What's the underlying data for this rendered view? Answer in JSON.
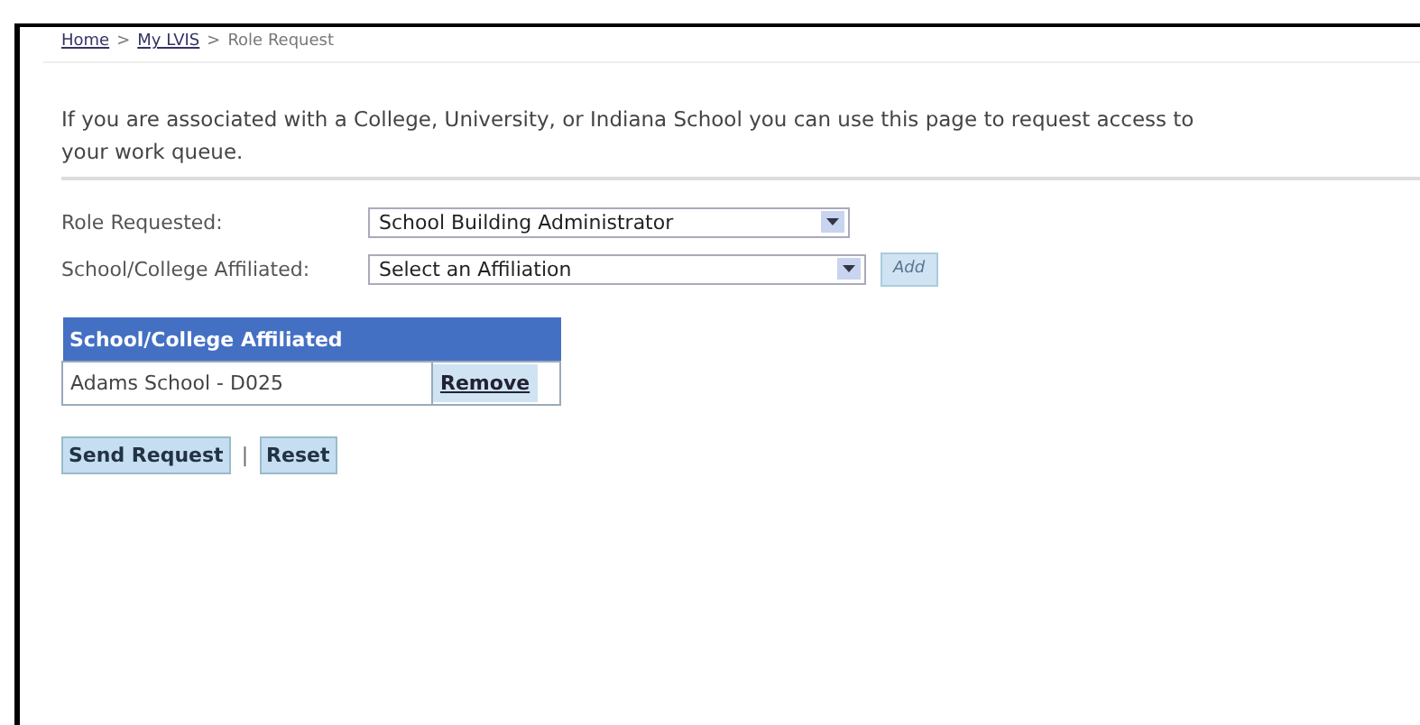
{
  "breadcrumb": [
    {
      "label": "Home",
      "link": true
    },
    {
      "label": "My LVIS",
      "link": true
    },
    {
      "label": "Role Request",
      "link": false
    }
  ],
  "breadcrumb_separator": ">",
  "intro": [
    "If you are associated with a College, University, or Indiana School you can use this page to request access to",
    "your work queue."
  ],
  "form": [
    {
      "label": "Role Requested:",
      "value": "School Building Administrator"
    },
    {
      "label": "School/College Affiliated:",
      "value": "Select an Affiliation",
      "add_button": {
        "label": "Add",
        "disabled": true
      }
    }
  ],
  "table": {
    "columns": [
      "School/College Affiliated"
    ],
    "rows": [
      {
        "name": "Adams School - D025",
        "action": "Remove"
      }
    ]
  },
  "buttons": [
    "Send Request",
    "Reset"
  ],
  "button_separator": "|"
}
